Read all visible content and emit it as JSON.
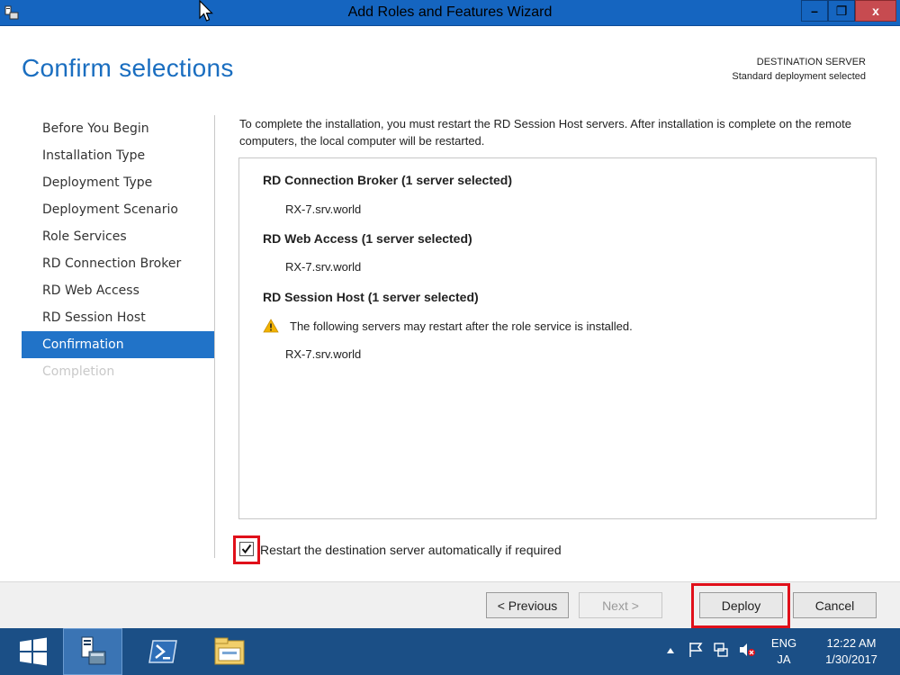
{
  "window": {
    "title": "Add Roles and Features Wizard",
    "minimize_glyph": "–",
    "restore_glyph": "❐",
    "close_glyph": "x"
  },
  "page": {
    "heading": "Confirm selections",
    "destination_label": "DESTINATION SERVER",
    "destination_value": "Standard deployment selected",
    "description": "To complete the installation, you must restart the RD Session Host servers. After installation is complete on the remote computers, the local computer will be restarted."
  },
  "nav": {
    "items": [
      {
        "label": "Before You Begin",
        "state": "normal"
      },
      {
        "label": "Installation Type",
        "state": "normal"
      },
      {
        "label": "Deployment Type",
        "state": "normal"
      },
      {
        "label": "Deployment Scenario",
        "state": "normal"
      },
      {
        "label": "Role Services",
        "state": "normal"
      },
      {
        "label": "RD Connection Broker",
        "state": "normal"
      },
      {
        "label": "RD Web Access",
        "state": "normal"
      },
      {
        "label": "RD Session Host",
        "state": "normal"
      },
      {
        "label": "Confirmation",
        "state": "active"
      },
      {
        "label": "Completion",
        "state": "disabled"
      }
    ]
  },
  "selections": {
    "broker_title": "RD Connection Broker  (1 server selected)",
    "broker_server": "RX-7.srv.world",
    "web_title": "RD Web Access  (1 server selected)",
    "web_server": "RX-7.srv.world",
    "session_title": "RD Session Host  (1 server selected)",
    "session_warning": "The following servers may restart after the role service is installed.",
    "session_server": "RX-7.srv.world"
  },
  "restart_checkbox": {
    "label": "Restart the destination server automatically if required",
    "checked": true
  },
  "buttons": {
    "previous": "< Previous",
    "next": "Next >",
    "deploy": "Deploy",
    "cancel": "Cancel"
  },
  "taskbar": {
    "lang_top": "ENG",
    "lang_bottom": "JA",
    "time": "12:22 AM",
    "date": "1/30/2017"
  },
  "icons": [
    "window-app-icon",
    "cursor-icon",
    "warning-icon",
    "start-icon",
    "server-manager-icon",
    "powershell-icon",
    "file-explorer-icon",
    "tray-overflow-icon",
    "flag-icon",
    "network-icon",
    "speaker-muted-icon"
  ],
  "colors": {
    "accent": "#2173c8",
    "heading": "#1a6ec0",
    "titlebar": "#1565c0",
    "taskbar": "#1b4f86",
    "highlight_red": "#e0101a"
  }
}
